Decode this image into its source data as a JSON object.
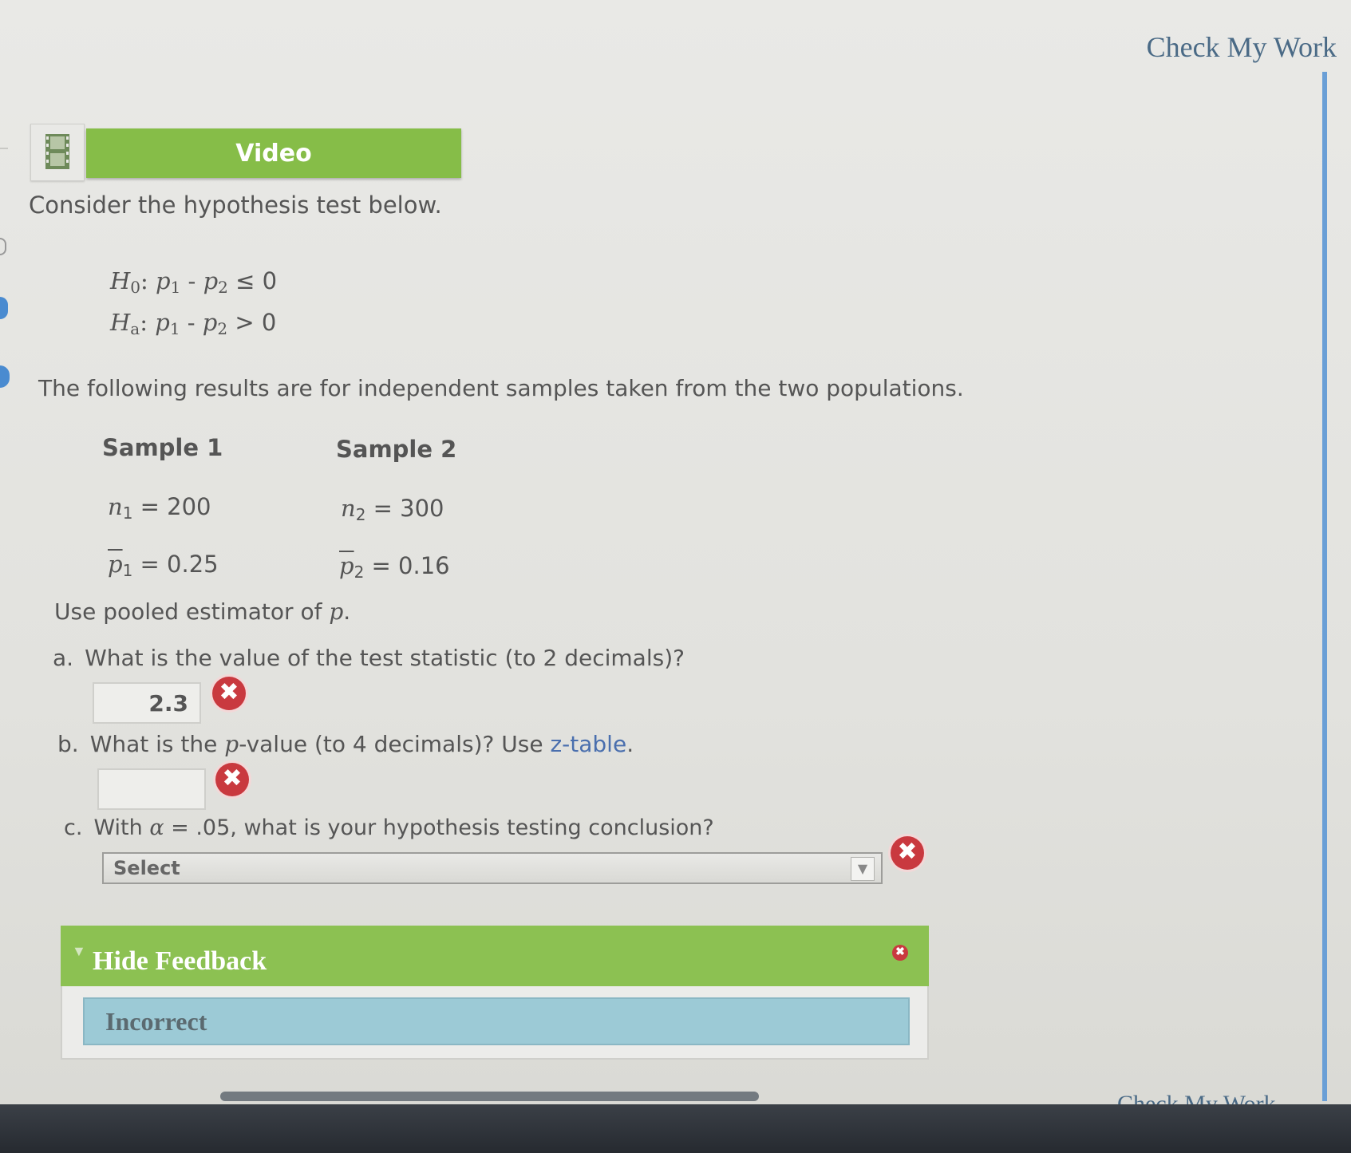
{
  "header": {
    "check_my_work": "Check My Work"
  },
  "video": {
    "label": "Video"
  },
  "intro": "Consider the hypothesis test below.",
  "hypotheses": {
    "h0": {
      "H": "H",
      "sub": "0",
      "colon": ":",
      "p1": "p",
      "p1_sub": "1",
      "minus": " - ",
      "p2": "p",
      "p2_sub": "2",
      "relation": " ≤ 0"
    },
    "ha": {
      "H": "H",
      "sub": "a",
      "colon": ":",
      "p1": "p",
      "p1_sub": "1",
      "minus": " - ",
      "p2": "p",
      "p2_sub": "2",
      "relation": " > 0"
    }
  },
  "results_text": "The following results are for independent samples taken from the two populations.",
  "samples": {
    "sample1": {
      "title": "Sample 1",
      "n_letter": "n",
      "n_sub": "1",
      "n_value": " = 200",
      "p_letter": "p",
      "p_sub": "1",
      "p_value": " = 0.25"
    },
    "sample2": {
      "title": "Sample 2",
      "n_letter": "n",
      "n_sub": "2",
      "n_value": " = 300",
      "p_letter": "p",
      "p_sub": "2",
      "p_value": " = 0.16"
    }
  },
  "pooled": {
    "prefix": "Use pooled estimator of ",
    "p": "p",
    "suffix": "."
  },
  "questions": {
    "a": {
      "label": "a.",
      "text": "What is the value of the test statistic (to 2 decimals)?",
      "answer": "2.3",
      "status_icon": "✖"
    },
    "b": {
      "label": "b.",
      "pre": "What is the ",
      "p": "p",
      "mid": "-value (to 4 decimals)? Use ",
      "link": "z-table",
      "post": ".",
      "answer": "",
      "status_icon": "✖"
    },
    "c": {
      "label": "c.",
      "pre": "With ",
      "alpha": "α",
      "post": " = .05, what is your hypothesis testing conclusion?",
      "select_value": "Select",
      "status_icon": "✖"
    }
  },
  "feedback": {
    "toggle_label": "Hide Feedback",
    "result": "Incorrect",
    "close_icon": "✖"
  },
  "footer": {
    "check_my_work": "Check My Work"
  },
  "colors": {
    "green": "#86bd48",
    "error_red": "#c9393f",
    "link_blue": "#4a6a86",
    "feedback_blue": "#9ccad6"
  }
}
